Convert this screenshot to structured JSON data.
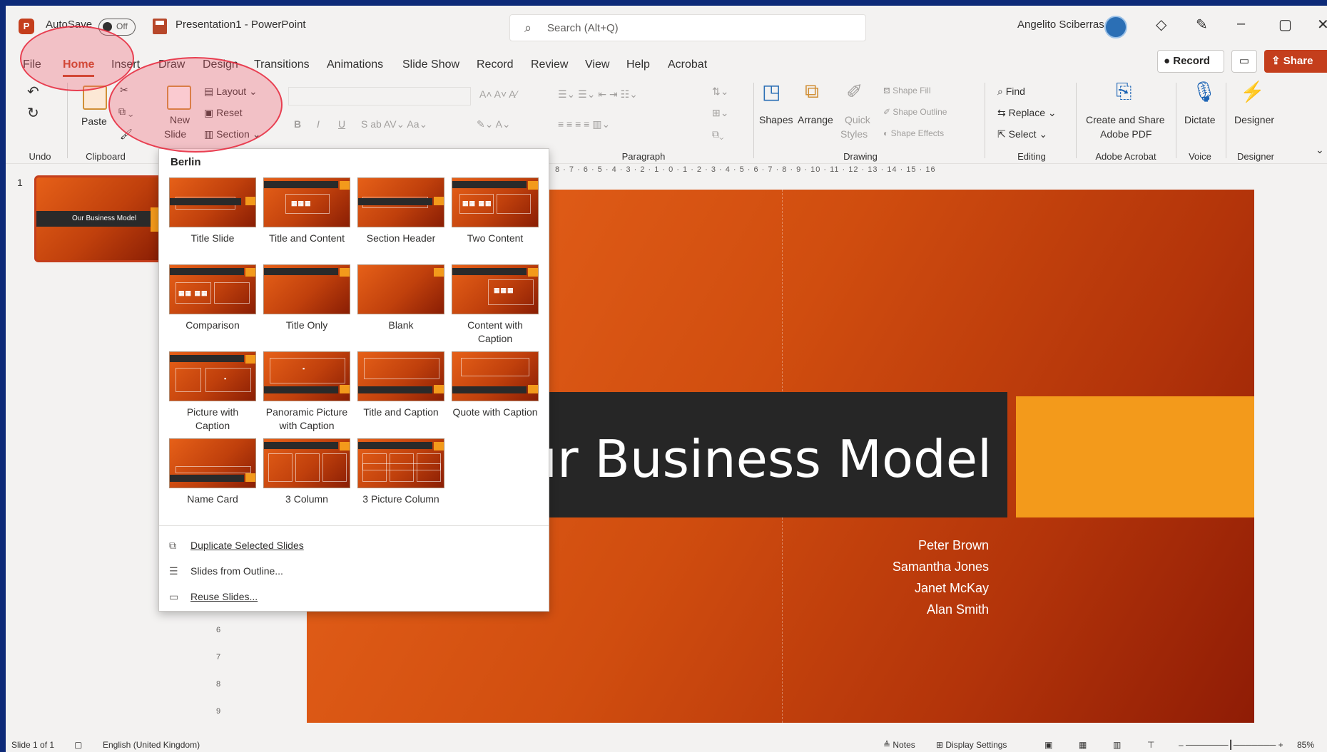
{
  "titlebar": {
    "autosave_label": "AutoSave",
    "autosave_state": "Off",
    "doc_title": "Presentation1 - PowerPoint",
    "search_placeholder": "Search (Alt+Q)",
    "user_name": "Angelito Sciberras"
  },
  "tabs": [
    "File",
    "Home",
    "Insert",
    "Draw",
    "Design",
    "Transitions",
    "Animations",
    "Slide Show",
    "Record",
    "Review",
    "View",
    "Help",
    "Acrobat"
  ],
  "active_tab": "Home",
  "header_buttons": {
    "record": "Record",
    "share": "Share"
  },
  "ribbon": {
    "groups": {
      "undo": "Undo",
      "clipboard": "Clipboard",
      "paragraph": "Paragraph",
      "drawing": "Drawing",
      "editing": "Editing",
      "adobe": "Adobe Acrobat",
      "voice": "Voice",
      "designer": "Designer"
    },
    "paste": "Paste",
    "new_slide": "New",
    "new_slide_2": "Slide",
    "layout": "Layout",
    "reset": "Reset",
    "section": "Section",
    "shapes": "Shapes",
    "arrange": "Arrange",
    "quick_styles": "Quick",
    "quick_styles_2": "Styles",
    "shape_fill": "Shape Fill",
    "shape_outline": "Shape Outline",
    "shape_effects": "Shape Effects",
    "find": "Find",
    "replace": "Replace",
    "select": "Select",
    "create_share_pdf": "Create and Share",
    "create_share_pdf_2": "Adobe PDF",
    "dictate": "Dictate",
    "designer_btn": "Designer"
  },
  "layout_menu": {
    "theme": "Berlin",
    "layouts": [
      "Title Slide",
      "Title and Content",
      "Section Header",
      "Two Content",
      "Comparison",
      "Title Only",
      "Blank",
      "Content with Caption",
      "Picture with Caption",
      "Panoramic Picture with Caption",
      "Title and Caption",
      "Quote with Caption",
      "Name Card",
      "3 Column",
      "3 Picture Column"
    ],
    "actions": [
      "Duplicate Selected Slides",
      "Slides from Outline...",
      "Reuse Slides..."
    ]
  },
  "slide_pane": {
    "slide_number": "1",
    "thumb_title": "Our Business Model"
  },
  "slide": {
    "title": "Our Business Model",
    "names": [
      "Peter Brown",
      "Samantha Jones",
      "Janet McKay",
      "Alan Smith"
    ]
  },
  "ruler": {
    "h": "8 · 7 · 6 · 5 · 4 · 3 · 2 · 1 · 0 · 1 · 2 · 3 · 4 · 5 · 6 · 7 · 8 · 9 · 10 · 11 · 12 · 13 · 14 · 15 · 16",
    "v": [
      "6",
      "7",
      "8",
      "9"
    ]
  },
  "statusbar": {
    "slide_count": "Slide 1 of 1",
    "language": "English (United Kingdom)",
    "notes": "Notes",
    "display_settings": "Display Settings",
    "zoom": "85%"
  },
  "colors": {
    "accent": "#c43e1c",
    "slide_orange": "#f39a1b",
    "slide_dark_band": "#262626"
  },
  "icons": [
    "powerpoint-logo",
    "save-icon",
    "search-icon",
    "premium-diamond-icon",
    "pen-icon",
    "minimize-icon",
    "restore-icon",
    "close-icon",
    "comment-icon",
    "share-icon"
  ]
}
